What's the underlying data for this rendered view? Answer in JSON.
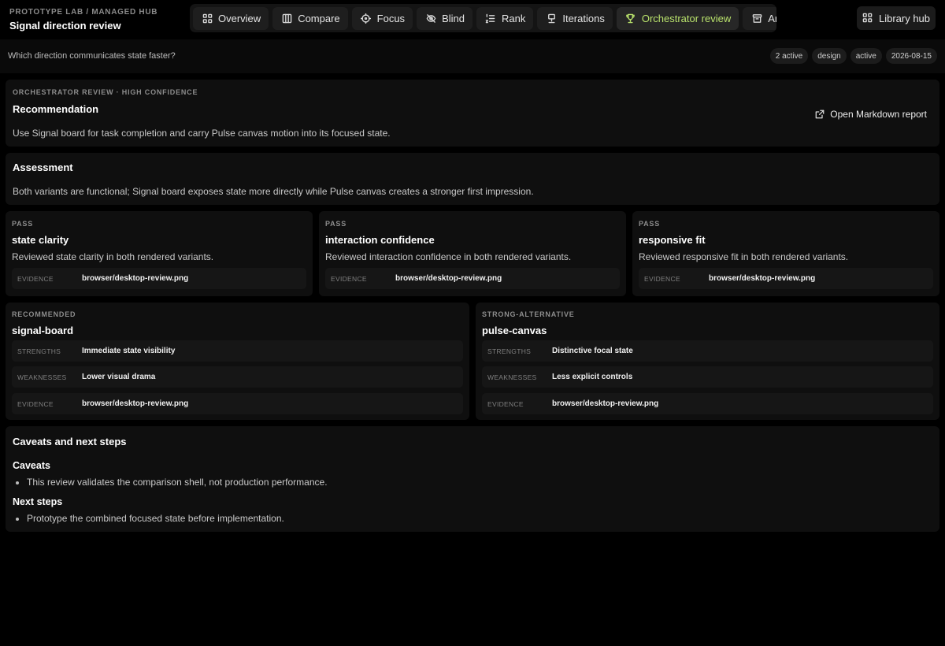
{
  "header": {
    "eyebrow": "PROTOTYPE LAB / MANAGED HUB",
    "title": "Signal direction review"
  },
  "tabs": [
    {
      "label": "Overview",
      "icon": "grid-icon"
    },
    {
      "label": "Compare",
      "icon": "columns-icon"
    },
    {
      "label": "Focus",
      "icon": "crosshair-icon"
    },
    {
      "label": "Blind",
      "icon": "eye-off-icon"
    },
    {
      "label": "Rank",
      "icon": "list-ordered-icon"
    },
    {
      "label": "Iterations",
      "icon": "monitor-icon"
    },
    {
      "label": "Orchestrator review",
      "icon": "trophy-icon",
      "active": true
    },
    {
      "label": "Archive",
      "icon": "archive-icon"
    }
  ],
  "library_button": {
    "label": "Library hub",
    "icon": "grid-icon"
  },
  "subheader": {
    "question": "Which direction communicates state faster?",
    "pills": [
      "2 active",
      "design",
      "active",
      "2026-08-15"
    ]
  },
  "recommendation": {
    "eyebrow": "ORCHESTRATOR REVIEW · HIGH CONFIDENCE",
    "title": "Recommendation",
    "text": "Use Signal board for task completion and carry Pulse canvas motion into its focused state.",
    "open_report_label": "Open Markdown report"
  },
  "assessment": {
    "title": "Assessment",
    "text": "Both variants are functional; Signal board exposes state more directly while Pulse canvas creates a stronger first impression."
  },
  "criteria": [
    {
      "status": "PASS",
      "name": "state clarity",
      "text": "Reviewed state clarity in both rendered variants.",
      "evidence_label": "EVIDENCE",
      "evidence": "browser/desktop-review.png"
    },
    {
      "status": "PASS",
      "name": "interaction confidence",
      "text": "Reviewed interaction confidence in both rendered variants.",
      "evidence_label": "EVIDENCE",
      "evidence": "browser/desktop-review.png"
    },
    {
      "status": "PASS",
      "name": "responsive fit",
      "text": "Reviewed responsive fit in both rendered variants.",
      "evidence_label": "EVIDENCE",
      "evidence": "browser/desktop-review.png"
    }
  ],
  "variants": [
    {
      "rank": "RECOMMENDED",
      "name": "signal-board",
      "rows": [
        {
          "label": "STRENGTHS",
          "value": "Immediate state visibility"
        },
        {
          "label": "WEAKNESSES",
          "value": "Lower visual drama"
        },
        {
          "label": "EVIDENCE",
          "value": "browser/desktop-review.png"
        }
      ]
    },
    {
      "rank": "STRONG-ALTERNATIVE",
      "name": "pulse-canvas",
      "rows": [
        {
          "label": "STRENGTHS",
          "value": "Distinctive focal state"
        },
        {
          "label": "WEAKNESSES",
          "value": "Less explicit controls"
        },
        {
          "label": "EVIDENCE",
          "value": "browser/desktop-review.png"
        }
      ]
    }
  ],
  "caveats_section": {
    "title": "Caveats and next steps",
    "caveats_title": "Caveats",
    "caveats": [
      "This review validates the comparison shell, not production performance."
    ],
    "next_title": "Next steps",
    "next_steps": [
      "Prototype the combined focused state before implementation."
    ]
  }
}
